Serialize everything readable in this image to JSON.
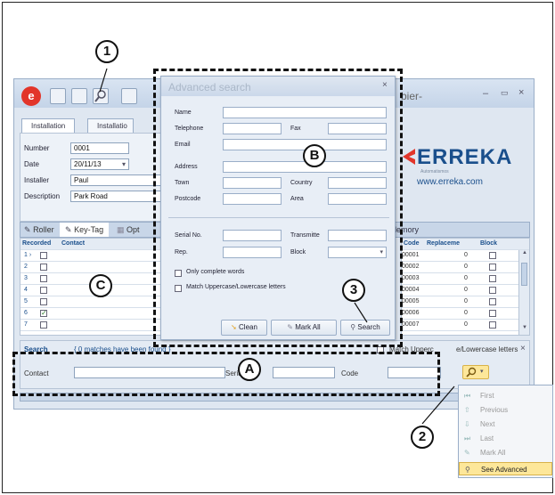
{
  "callouts": {
    "c1": "1",
    "c2": "2",
    "c3": "3",
    "ca": "A",
    "cb": "B",
    "cc": "C"
  },
  "window": {
    "title_fragment": "bier-",
    "min": "–",
    "max": "▭",
    "close": "×",
    "tabs": [
      "Installation",
      "Installatio"
    ],
    "fields": [
      {
        "label": "Number",
        "value": "0001"
      },
      {
        "label": "Date",
        "value": "20/11/13"
      },
      {
        "label": "Installer",
        "value": "Paul"
      },
      {
        "label": "Description",
        "value": "Park Road"
      }
    ],
    "brand": {
      "name": "ERREKA",
      "sub": "Automatismos",
      "url": "www.erreka.com"
    },
    "subtabs": [
      "Roller",
      "Key-Tag",
      "Opt"
    ],
    "memory_label": "lemory",
    "left_grid": {
      "headers": [
        "Recorded",
        "Contact"
      ],
      "rows": [
        {
          "n": "1 ›",
          "checked": false
        },
        {
          "n": "2",
          "checked": false
        },
        {
          "n": "3",
          "checked": false
        },
        {
          "n": "4",
          "checked": false
        },
        {
          "n": "5",
          "checked": false
        },
        {
          "n": "6",
          "checked": true
        },
        {
          "n": "7",
          "checked": false
        }
      ]
    },
    "right_grid": {
      "headers": [
        "Code",
        "Replaceme",
        "Block"
      ],
      "rows": [
        {
          "code": "00001",
          "rep": "0"
        },
        {
          "code": "00002",
          "rep": "0"
        },
        {
          "code": "00003",
          "rep": "0"
        },
        {
          "code": "00004",
          "rep": "0"
        },
        {
          "code": "00005",
          "rep": "0"
        },
        {
          "code": "00006",
          "rep": "0"
        },
        {
          "code": "00007",
          "rep": "0"
        }
      ]
    }
  },
  "searchbar": {
    "title": "Search",
    "status": "{ 0 matches have been found }",
    "match_case": "Match Upperc",
    "match_case_tail": "e/Lowercase letters",
    "close": "×",
    "contact_label": "Contact",
    "serial_label": "Seria",
    "code_label": "Code"
  },
  "dialog": {
    "title": "Advanced search",
    "close": "×",
    "labels": {
      "name": "Name",
      "telephone": "Telephone",
      "fax": "Fax",
      "email": "Email",
      "address": "Address",
      "town": "Town",
      "country": "Country",
      "postcode": "Postcode",
      "area": "Area",
      "serial": "Serial No.",
      "transmitter": "Transmitte",
      "rep": "Rep.",
      "block": "Block"
    },
    "opt_complete": "Only complete words",
    "opt_case": "Match Uppercase/Lowercase letters",
    "btn_clean": "Clean",
    "btn_markall": "Mark All",
    "btn_search": "Search"
  },
  "menu": {
    "items": [
      {
        "label": "First",
        "icon": "first-icon"
      },
      {
        "label": "Previous",
        "icon": "previous-icon"
      },
      {
        "label": "Next",
        "icon": "next-icon"
      },
      {
        "label": "Last",
        "icon": "last-icon"
      },
      {
        "label": "Mark All",
        "icon": "mark-all-icon"
      },
      {
        "label": "See Advanced",
        "icon": "search-icon"
      }
    ]
  },
  "colors": {
    "accent": "#e2352a",
    "brand": "#1a4f8c",
    "selected": "#fde79a"
  }
}
